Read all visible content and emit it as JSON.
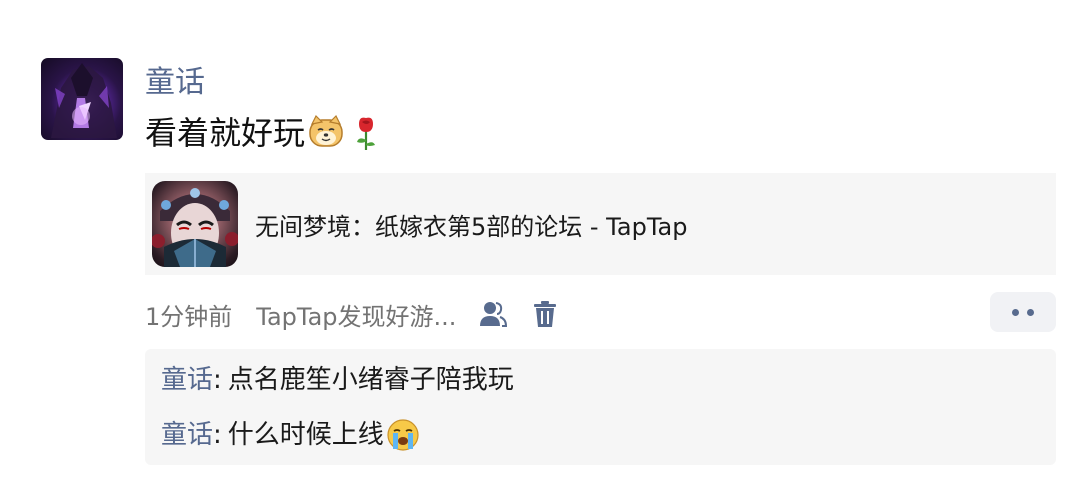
{
  "post": {
    "author": "童话",
    "text": "看着就好玩",
    "emojis": [
      "dog-face-emoji",
      "rose-emoji"
    ]
  },
  "link_card": {
    "title": "无间梦境：纸嫁衣第5部的论坛 - TapTap",
    "thumbnail_icon": "opera-mask-game-icon"
  },
  "meta": {
    "time": "1分钟前",
    "source": "TapTap发现好游...",
    "icons": [
      "friends-icon",
      "trash-icon",
      "more-icon"
    ]
  },
  "comments": [
    {
      "author": "童话",
      "separator": ":",
      "text": "点名鹿笙小绪睿子陪我玩"
    },
    {
      "author": "童话",
      "separator": ":",
      "text": "什么时候上线",
      "emoji": "crying-face-emoji"
    }
  ],
  "colors": {
    "name_blue": "#56698f",
    "card_bg": "#f6f6f6",
    "meta_gray": "#737373"
  }
}
